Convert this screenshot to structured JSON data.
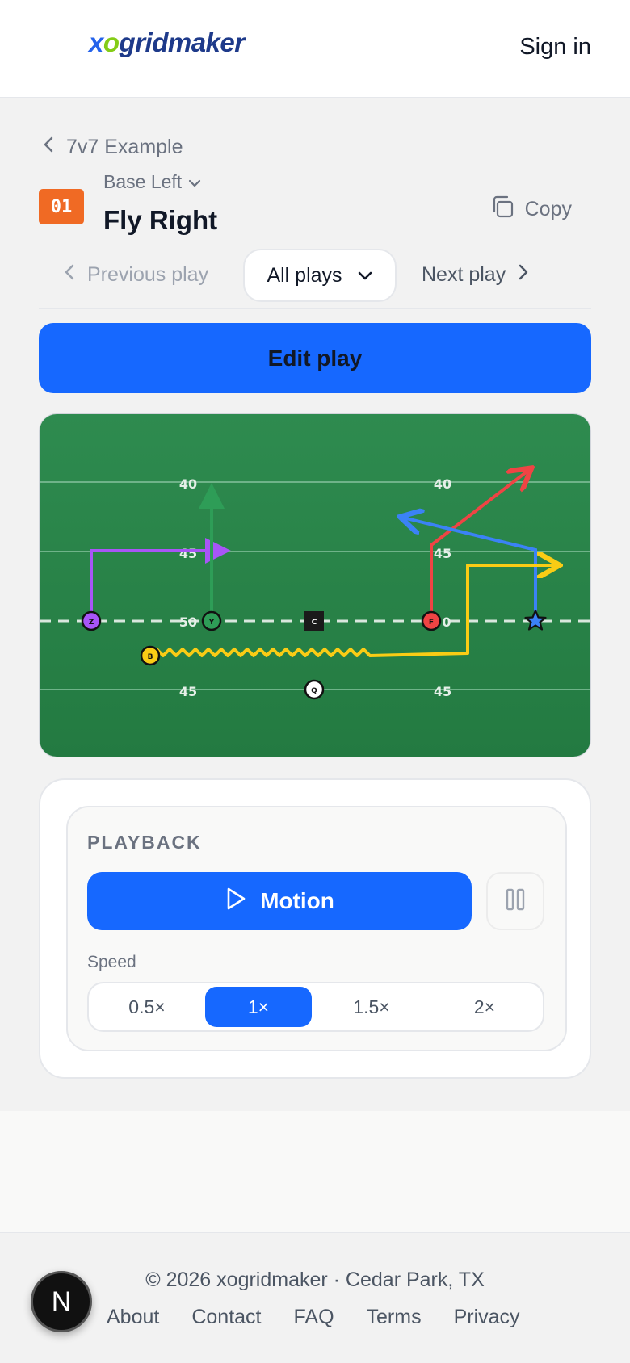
{
  "header": {
    "logo": {
      "x": "x",
      "o": "o",
      "rest": "gridmaker"
    },
    "signin": "Sign in"
  },
  "breadcrumb": {
    "label": "7v7 Example"
  },
  "play": {
    "number": "01",
    "formation": "Base Left",
    "name": "Fly Right",
    "copy_label": "Copy"
  },
  "nav": {
    "previous": "Previous play",
    "all": "All plays",
    "next": "Next play"
  },
  "edit_label": "Edit play",
  "field": {
    "yard_labels_top": [
      "40",
      "40"
    ],
    "yard_labels_mid": [
      "45",
      "45"
    ],
    "yard_labels_los": [
      "50",
      "0"
    ],
    "yard_labels_bottom": [
      "45",
      "45"
    ],
    "players": {
      "z": "Z",
      "y": "Y",
      "c": "C",
      "f": "F",
      "b": "B",
      "q": "Q"
    },
    "colors": {
      "field_top": "#2e8b4f",
      "field_bottom": "#237a41",
      "purple": "#a855f7",
      "green": "#2e9d57",
      "red": "#ef4444",
      "blue": "#3b82f6",
      "yellow": "#facc15"
    }
  },
  "playback": {
    "title": "PLAYBACK",
    "motion_label": "Motion",
    "speed_label": "Speed",
    "speeds": [
      "0.5×",
      "1×",
      "1.5×",
      "2×"
    ],
    "active_speed": "1×"
  },
  "footer": {
    "copyright": "© 2026 xogridmaker · Cedar Park, TX",
    "links": [
      "About",
      "Contact",
      "FAQ",
      "Terms",
      "Privacy"
    ]
  },
  "fab_label": "N"
}
